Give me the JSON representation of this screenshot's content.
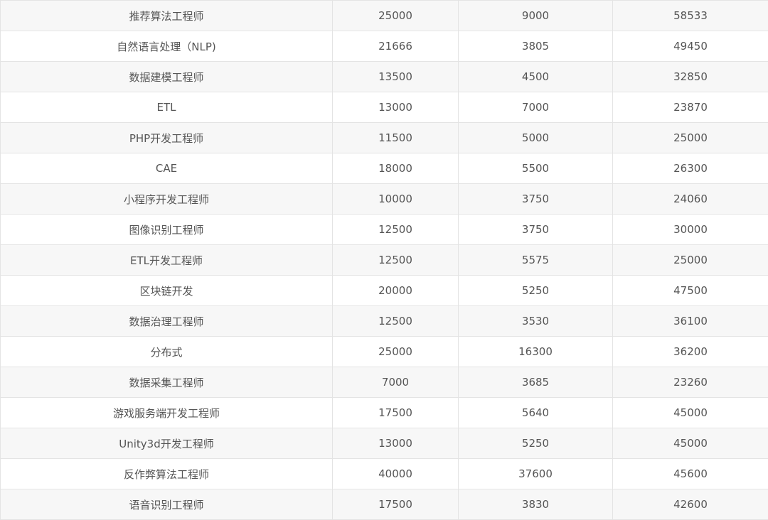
{
  "table": {
    "rows": [
      [
        "推荐算法工程师",
        "25000",
        "9000",
        "58533"
      ],
      [
        "自然语言处理（NLP)",
        "21666",
        "3805",
        "49450"
      ],
      [
        "数据建模工程师",
        "13500",
        "4500",
        "32850"
      ],
      [
        "ETL",
        "13000",
        "7000",
        "23870"
      ],
      [
        "PHP开发工程师",
        "11500",
        "5000",
        "25000"
      ],
      [
        "CAE",
        "18000",
        "5500",
        "26300"
      ],
      [
        "小程序开发工程师",
        "10000",
        "3750",
        "24060"
      ],
      [
        "图像识别工程师",
        "12500",
        "3750",
        "30000"
      ],
      [
        "ETL开发工程师",
        "12500",
        "5575",
        "25000"
      ],
      [
        "区块链开发",
        "20000",
        "5250",
        "47500"
      ],
      [
        "数据治理工程师",
        "12500",
        "3530",
        "36100"
      ],
      [
        "分布式",
        "25000",
        "16300",
        "36200"
      ],
      [
        "数据采集工程师",
        "7000",
        "3685",
        "23260"
      ],
      [
        "游戏服务端开发工程师",
        "17500",
        "5640",
        "45000"
      ],
      [
        "Unity3d开发工程师",
        "13000",
        "5250",
        "45000"
      ],
      [
        "反作弊算法工程师",
        "40000",
        "37600",
        "45600"
      ],
      [
        "语音识别工程师",
        "17500",
        "3830",
        "42600"
      ]
    ]
  }
}
